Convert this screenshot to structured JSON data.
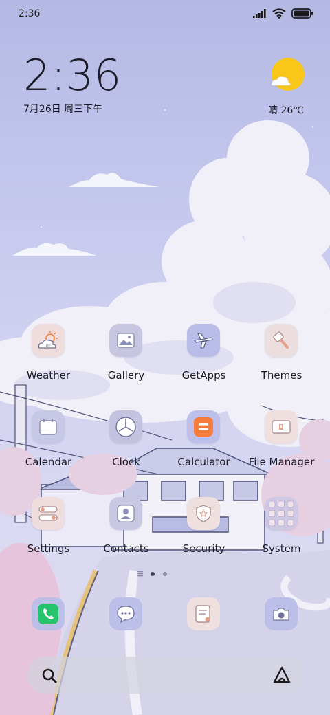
{
  "status_bar": {
    "time": "2:36",
    "battery_icon": "battery-full-icon",
    "wifi_icon": "wifi-icon",
    "signal_icon": "cellular-signal-icon"
  },
  "clock_widget": {
    "time": "2:36",
    "date": "7月26日 周三下午"
  },
  "weather_widget": {
    "icon": "sun-cloud-icon",
    "text": "晴 26℃"
  },
  "apps": [
    {
      "label": "Weather",
      "icon": "weather-icon",
      "bg": "#efdcdc"
    },
    {
      "label": "Gallery",
      "icon": "gallery-icon",
      "bg": "#c7c5e0"
    },
    {
      "label": "GetApps",
      "icon": "airplane-icon",
      "bg": "#b8bce6"
    },
    {
      "label": "Themes",
      "icon": "paintbrush-icon",
      "bg": "#ecdede"
    },
    {
      "label": "Calendar",
      "icon": "calendar-icon",
      "bg": "#c6c8e6"
    },
    {
      "label": "Clock",
      "icon": "clock-icon",
      "bg": "#c3c3e0"
    },
    {
      "label": "Calculator",
      "icon": "calculator-icon",
      "bg": "#bcc0ea"
    },
    {
      "label": "File Manager",
      "icon": "folder-icon",
      "bg": "#efdfdf"
    },
    {
      "label": "Settings",
      "icon": "settings-toggle-icon",
      "bg": "#efdcdc"
    },
    {
      "label": "Contacts",
      "icon": "contact-person-icon",
      "bg": "#c8c8e3"
    },
    {
      "label": "Security",
      "icon": "shield-icon",
      "bg": "#efe0e0"
    },
    {
      "label": "System",
      "icon": "app-grid-icon",
      "bg": "#cec8e4"
    }
  ],
  "dock": [
    {
      "icon": "phone-icon",
      "bg": "#bcc0e8"
    },
    {
      "icon": "message-icon",
      "bg": "#bcc0e8"
    },
    {
      "icon": "notes-icon",
      "bg": "#efdfdf"
    },
    {
      "icon": "camera-icon",
      "bg": "#bcc0e8"
    }
  ],
  "search_bar": {
    "search_icon": "search-icon",
    "assistant_icon": "assistant-logo-icon"
  },
  "colors": {
    "accent_orange": "#f57c3a",
    "phone_green": "#25c36b",
    "sun_yellow": "#f9c61a",
    "label": "#1c1c28"
  }
}
